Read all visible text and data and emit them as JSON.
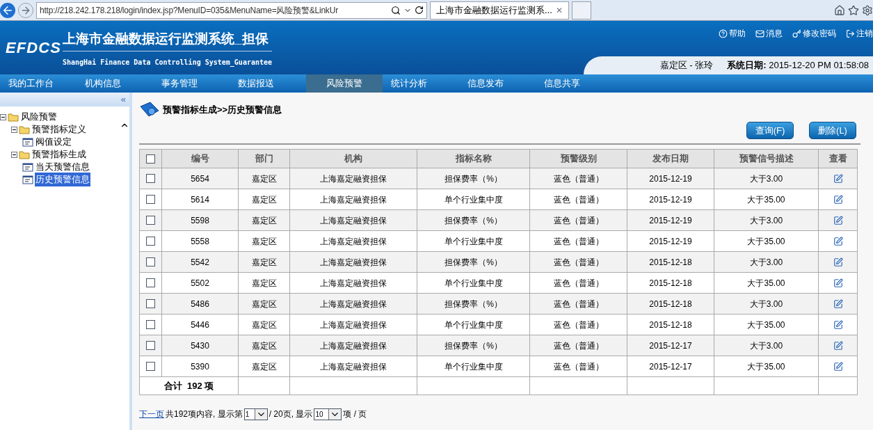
{
  "browser": {
    "url": "http://218.242.178.218/login/index.jsp?MenuID=035&MenuName=风险预警&LinkUr",
    "tab_title": "上海市金融数据运行监测系...",
    "tab_close": "✕"
  },
  "header": {
    "logo": "EFDCS",
    "title": "上海市金融数据运行监测系统_担保",
    "subtitle": "ShangHai Finance Data Controlling System_Guarantee",
    "links": [
      {
        "label": "帮助"
      },
      {
        "label": "消息"
      },
      {
        "label": "修改密码"
      },
      {
        "label": "注销"
      }
    ],
    "user": "嘉定区 - 张玲",
    "date_label": "系统日期:",
    "date": "2015-12-20 PM 01:58:08"
  },
  "nav": [
    {
      "label": "我的工作台",
      "selected": false
    },
    {
      "label": "机构信息",
      "selected": false
    },
    {
      "label": "事务管理",
      "selected": false
    },
    {
      "label": "数据报送",
      "selected": false
    },
    {
      "label": "风险预警",
      "selected": true
    },
    {
      "label": "统计分析",
      "selected": false
    },
    {
      "label": "信息发布",
      "selected": false
    },
    {
      "label": "信息共享",
      "selected": false
    }
  ],
  "sidebar": {
    "collapse": "«",
    "tree": [
      {
        "kind": "folder",
        "label": "风险预警",
        "expanded": true,
        "selected": false,
        "children": [
          {
            "kind": "folder",
            "label": "预警指标定义",
            "expanded": true,
            "selected": false,
            "children": [
              {
                "kind": "page",
                "label": "阀值设定",
                "selected": false
              }
            ]
          },
          {
            "kind": "folder",
            "label": "预警指标生成",
            "expanded": true,
            "selected": false,
            "children": [
              {
                "kind": "page",
                "label": "当天预警信息",
                "selected": false
              },
              {
                "kind": "page",
                "label": "历史预警信息",
                "selected": true
              }
            ]
          }
        ]
      }
    ]
  },
  "breadcrumb": "预警指标生成>>历史预警信息",
  "buttons": [
    {
      "label": "查询(F)"
    },
    {
      "label": "删除(L)"
    }
  ],
  "table": {
    "header_checked": false,
    "columns": [
      "编号",
      "部门",
      "机构",
      "指标名称",
      "预警级别",
      "发布日期",
      "预警信号描述",
      "查看"
    ],
    "rows": [
      {
        "checked": false,
        "cells": [
          "5654",
          "嘉定区",
          "上海嘉定融资担保",
          "担保费率（%）",
          "蓝色（普通）",
          "2015-12-19",
          "大于3.00"
        ]
      },
      {
        "checked": false,
        "cells": [
          "5614",
          "嘉定区",
          "上海嘉定融资担保",
          "单个行业集中度",
          "蓝色（普通）",
          "2015-12-19",
          "大于35.00"
        ]
      },
      {
        "checked": false,
        "cells": [
          "5598",
          "嘉定区",
          "上海嘉定融资担保",
          "担保费率（%）",
          "蓝色（普通）",
          "2015-12-19",
          "大于3.00"
        ]
      },
      {
        "checked": false,
        "cells": [
          "5558",
          "嘉定区",
          "上海嘉定融资担保",
          "单个行业集中度",
          "蓝色（普通）",
          "2015-12-19",
          "大于35.00"
        ]
      },
      {
        "checked": false,
        "cells": [
          "5542",
          "嘉定区",
          "上海嘉定融资担保",
          "担保费率（%）",
          "蓝色（普通）",
          "2015-12-18",
          "大于3.00"
        ]
      },
      {
        "checked": false,
        "cells": [
          "5502",
          "嘉定区",
          "上海嘉定融资担保",
          "单个行业集中度",
          "蓝色（普通）",
          "2015-12-18",
          "大于35.00"
        ]
      },
      {
        "checked": false,
        "cells": [
          "5486",
          "嘉定区",
          "上海嘉定融资担保",
          "担保费率（%）",
          "蓝色（普通）",
          "2015-12-18",
          "大于3.00"
        ]
      },
      {
        "checked": false,
        "cells": [
          "5446",
          "嘉定区",
          "上海嘉定融资担保",
          "单个行业集中度",
          "蓝色（普通）",
          "2015-12-18",
          "大于35.00"
        ]
      },
      {
        "checked": false,
        "cells": [
          "5430",
          "嘉定区",
          "上海嘉定融资担保",
          "担保费率（%）",
          "蓝色（普通）",
          "2015-12-17",
          "大于3.00"
        ]
      },
      {
        "checked": false,
        "cells": [
          "5390",
          "嘉定区",
          "上海嘉定融资担保",
          "单个行业集中度",
          "蓝色（普通）",
          "2015-12-17",
          "大于35.00"
        ]
      }
    ],
    "total": "合计  192 项"
  },
  "pagination": {
    "next": "下一页",
    "text1": "共192项内容, 显示第",
    "page": "1",
    "text2": "/ 20页, 显示",
    "per_page": "10",
    "text3": "项 / 页"
  }
}
